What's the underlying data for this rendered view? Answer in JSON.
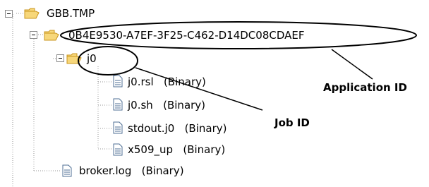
{
  "tree": {
    "root": {
      "label": "GBB.TMP",
      "expanded": true
    },
    "app_folder": {
      "label": "0B4E9530-A7EF-3F25-C462-D14DC08CDAEF",
      "expanded": true
    },
    "job_folder": {
      "label": "j0",
      "expanded": true
    },
    "job_files": [
      {
        "name": "j0.rsl",
        "type": "(Binary)"
      },
      {
        "name": "j0.sh",
        "type": "(Binary)"
      },
      {
        "name": "stdout.j0",
        "type": "(Binary)"
      },
      {
        "name": "x509_up",
        "type": "(Binary)"
      }
    ],
    "broker_log": {
      "name": "broker.log",
      "type": "(Binary)"
    }
  },
  "annotations": {
    "application_id": "Application ID",
    "job_id": "Job ID"
  },
  "colors": {
    "folder_fill": "#f7d77a",
    "folder_edge": "#c9941c",
    "tree_line": "#9a9a9a",
    "callout": "#000000"
  },
  "icons": {
    "folder": "folder-open-icon",
    "file": "document-icon",
    "expander": "minus-box-icon"
  }
}
